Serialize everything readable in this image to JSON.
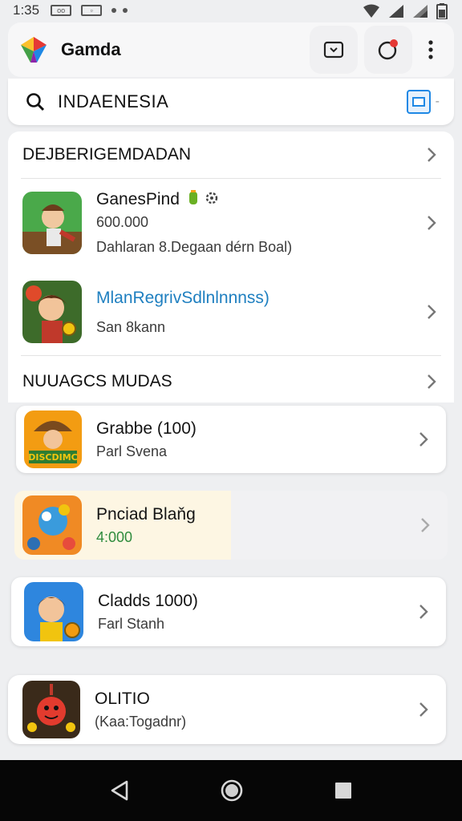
{
  "status": {
    "time": "1:35",
    "badge1": "oo",
    "badge2": "▫"
  },
  "app": {
    "title": "Gamda"
  },
  "search": {
    "value": "INDAENESIA"
  },
  "sections": [
    {
      "title": "DEJBERIGEMDADAN"
    },
    {
      "title": "NUUAGCS MUDAS"
    }
  ],
  "apps": [
    {
      "name": "GanesPind",
      "line1": "600.000",
      "line2": "Dahlaran 8.Degaan dérn Boal)"
    },
    {
      "name": "MlanRegrivSdlnlnnnss)",
      "line1": "San 8kann"
    },
    {
      "name": "Grabbe (100)",
      "line1": "Parl Svena"
    },
    {
      "name": "Pnciad Blaňg",
      "line1": "4:000"
    },
    {
      "name": "Cladds 1000)",
      "line1": "Farl Stanh"
    },
    {
      "name": "OLITIO",
      "line1": "(Kaa:Togadnr)"
    }
  ],
  "colors": {
    "accent": "#1e88e5",
    "link": "#1e7fc0",
    "price_green": "#2e8b3d",
    "highlight": "#fdf6e3",
    "nav_bg": "#060606"
  },
  "icons": [
    "app-logo-icon",
    "search-icon",
    "chat-icon",
    "notification-icon",
    "more-icon",
    "chevron-right-icon",
    "back-icon",
    "home-icon",
    "recents-icon"
  ]
}
